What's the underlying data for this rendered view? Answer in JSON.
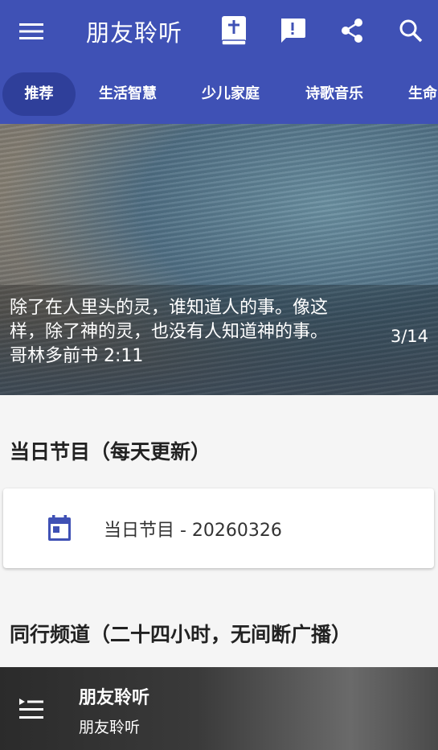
{
  "header": {
    "title": "朋友聆听",
    "icons": [
      "menu-icon",
      "bible-icon",
      "feedback-icon",
      "share-icon",
      "search-icon"
    ]
  },
  "tabs": [
    {
      "label": "推荐",
      "active": true
    },
    {
      "label": "生活智慧",
      "active": false
    },
    {
      "label": "少儿家庭",
      "active": false
    },
    {
      "label": "诗歌音乐",
      "active": false
    },
    {
      "label": "生命",
      "active": false
    }
  ],
  "banner": {
    "verse_line1": "除了在人里头的灵，谁知道人的事。像这",
    "verse_line2": "样，除了神的灵，也没有人知道神的事。",
    "reference": "哥林多前书 2:11",
    "counter": "3/14"
  },
  "daily": {
    "section_title": "当日节目（每天更新）",
    "item_label": "当日节目 - 20260326",
    "icon": "calendar-icon"
  },
  "channel": {
    "section_title": "同行频道（二十四小时，无间断广播）"
  },
  "player": {
    "title": "朋友聆听",
    "subtitle": "朋友聆听",
    "icon": "playlist-icon"
  },
  "colors": {
    "primary": "#3f51b5",
    "active_tab": "#2f3f9a",
    "accent_icon": "#3f51b5"
  }
}
